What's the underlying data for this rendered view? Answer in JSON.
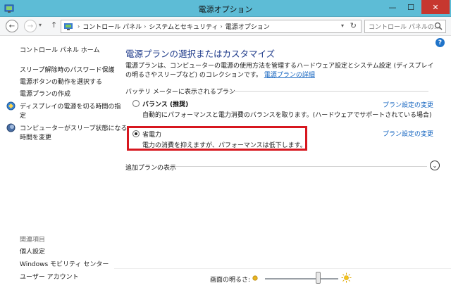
{
  "window": {
    "title": "電源オプション",
    "min_glyph": "—",
    "max_glyph": "☐",
    "close_glyph": "✕"
  },
  "nav": {
    "back_glyph": "←",
    "forward_glyph": "→",
    "dropdown_glyph": "▾",
    "up_glyph": "↑",
    "breadcrumb": [
      "コントロール パネル",
      "システムとセキュリティ",
      "電源オプション"
    ],
    "crumb_sep": "›",
    "addr_dropdown_glyph": "▾",
    "refresh_glyph": "↻",
    "search_placeholder": "コントロール パネルの..."
  },
  "sidebar": {
    "home": "コントロール パネル ホーム",
    "items": [
      "スリープ解除時のパスワード保護",
      "電源ボタンの動作を選択する",
      "電源プランの作成",
      "ディスプレイの電源を切る時間の指",
      "定",
      "コンピューターがスリープ状態になる",
      "時間を変更"
    ],
    "see_also_title": "関連項目",
    "see_also": [
      "個人設定",
      "Windows モビリティ センター",
      "ユーザー アカウント"
    ]
  },
  "main": {
    "help_glyph": "?",
    "heading": "電源プランの選択またはカスタマイズ",
    "description": "電源プランは、コンピューターの電源の使用方法を管理するハードウェア設定とシステム設定 (ディスプレイの明るさやスリープなど) のコレクションです。",
    "description_link": "電源プランの詳細",
    "section_label": "バッテリ メーターに表示されるプラン",
    "plans": [
      {
        "name": "バランス (推奨)",
        "description": "自動的にパフォーマンスと電力消費のバランスを取ります。(ハードウェアでサポートされている場合)",
        "link": "プラン設定の変更",
        "selected": false
      },
      {
        "name": "省電力",
        "description": "電力の消費を抑えますが、パフォーマンスは低下します。",
        "link": "プラン設定の変更",
        "selected": true
      }
    ],
    "more_plans_label": "追加プランの表示",
    "expand_glyph": "⌄"
  },
  "brightness": {
    "label": "画面の明るさ:",
    "level": 0.73
  },
  "colors": {
    "titlebar": "#5dbcd6",
    "close_button": "#c7372f",
    "heading": "#1e3a8a",
    "link": "#1565c0",
    "highlight_box": "#d7171f"
  }
}
